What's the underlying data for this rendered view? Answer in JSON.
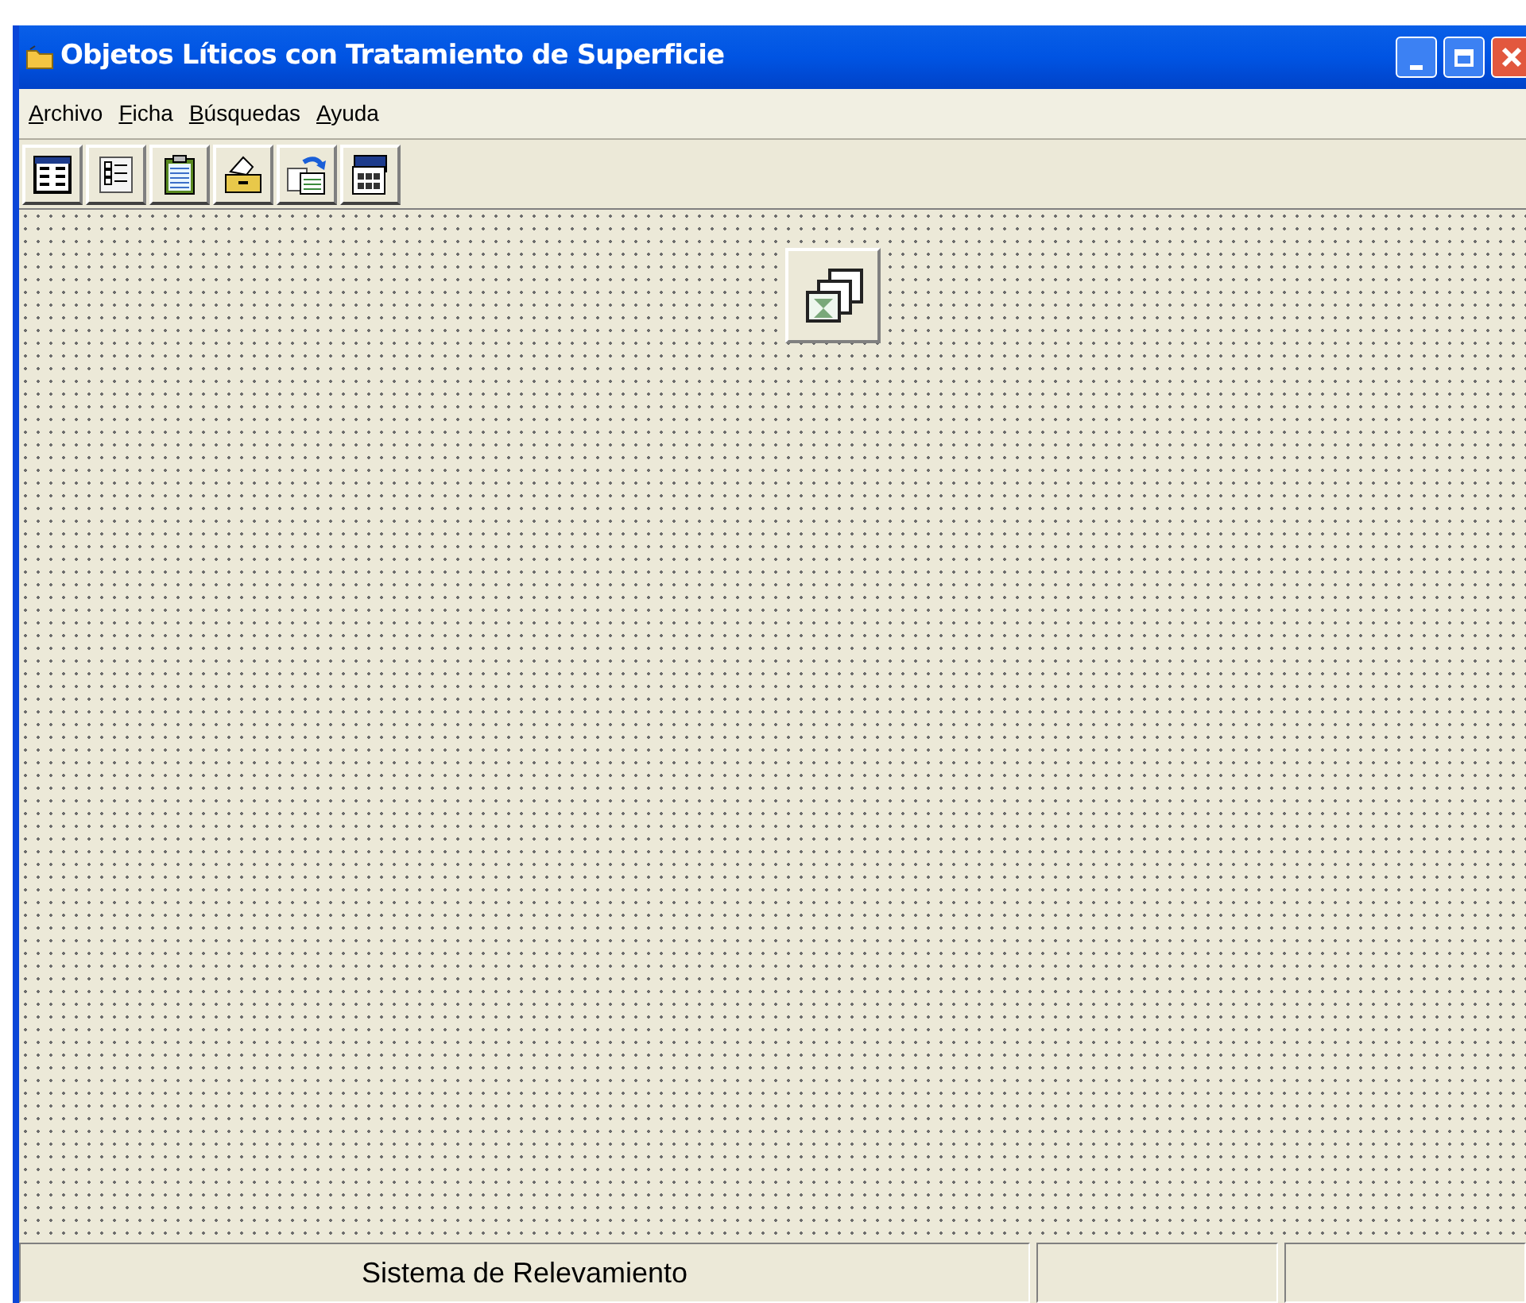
{
  "window": {
    "title": "Objetos Líticos con Tratamiento de Superficie"
  },
  "menu": [
    {
      "label": "Archivo"
    },
    {
      "label": "Ficha"
    },
    {
      "label": "Búsquedas"
    },
    {
      "label": "Ayuda"
    }
  ],
  "status_bar": {
    "text": "Sistema de Relevamiento"
  }
}
